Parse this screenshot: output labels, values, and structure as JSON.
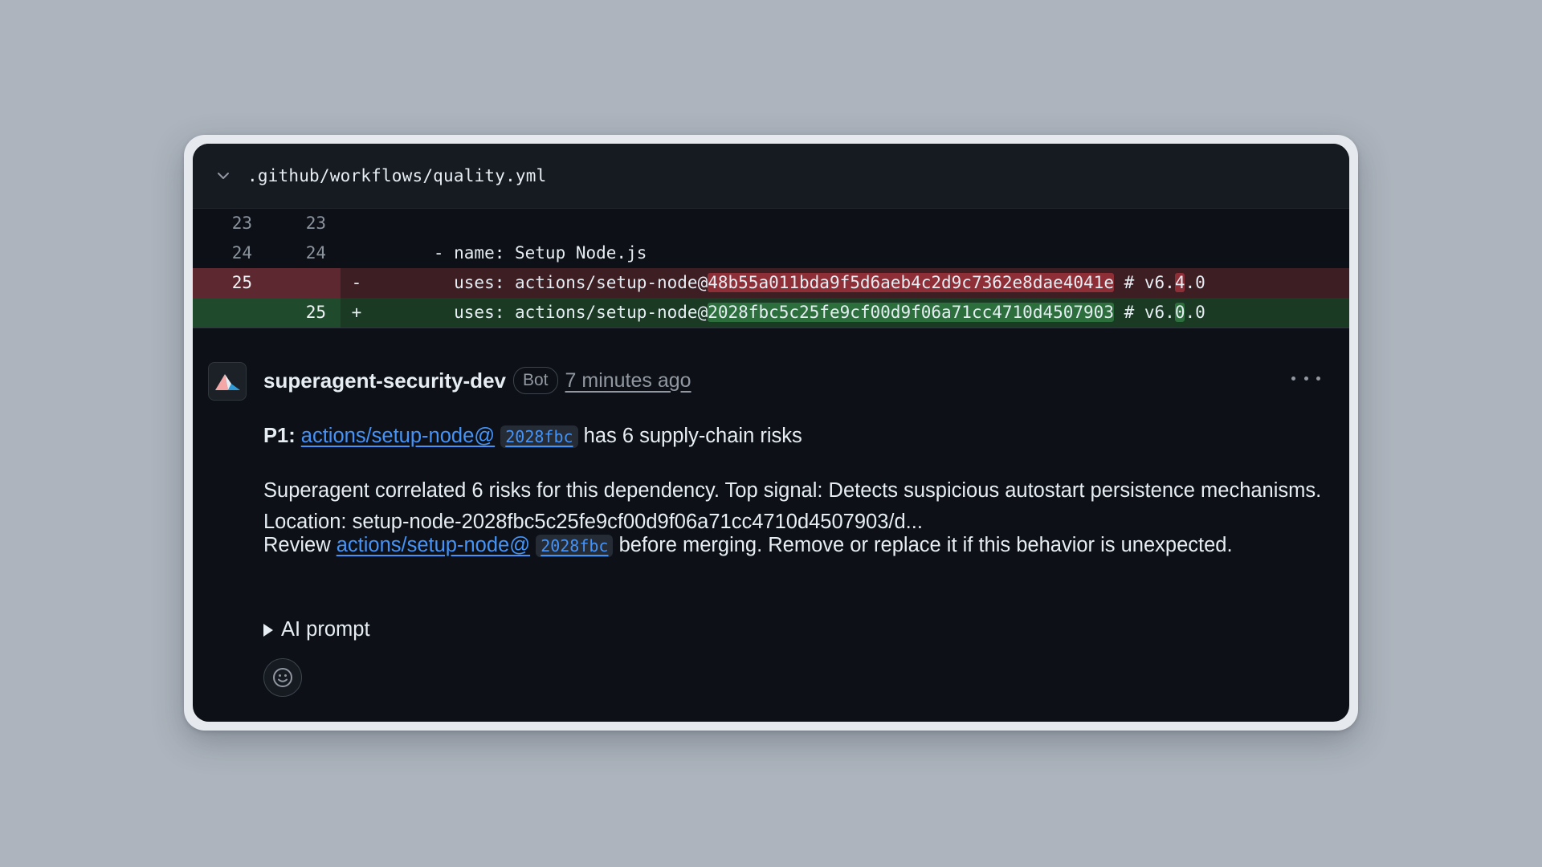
{
  "file": {
    "path": ".github/workflows/quality.yml"
  },
  "diff": {
    "rows": [
      {
        "old": "23",
        "new": "23",
        "sign": "",
        "code": ""
      },
      {
        "old": "24",
        "new": "24",
        "sign": "",
        "code": "      - name: Setup Node.js"
      },
      {
        "old": "25",
        "new": "",
        "sign": "-",
        "code_prefix": "        uses: actions/setup-node@",
        "code_hash": "48b55a011bda9f5d6aeb4c2d9c7362e8dae4041e",
        "code_mid": " # v6.",
        "code_ver": "4",
        "code_suffix": ".0"
      },
      {
        "old": "",
        "new": "25",
        "sign": "+",
        "code_prefix": "        uses: actions/setup-node@",
        "code_hash": "2028fbc5c25fe9cf00d9f06a71cc4710d4507903",
        "code_mid": " # v6.",
        "code_ver": "0",
        "code_suffix": ".0"
      }
    ]
  },
  "comment": {
    "author": "superagent-security-dev",
    "badge": "Bot",
    "time": "7 minutes ago",
    "title_prefix": "P1:",
    "title_link": "actions/setup-node@",
    "title_sha": "2028fbc",
    "title_suffix": "has 6 supply-chain risks",
    "description": "Superagent correlated 6 risks for this dependency. Top signal: Detects suspicious autostart persistence mechanisms. Location: setup-node-2028fbc5c25fe9cf00d9f06a71cc4710d4507903/d...",
    "review_prefix": "Review",
    "review_link": "actions/setup-node@",
    "review_sha": "2028fbc",
    "review_suffix": "before merging. Remove or replace it if this behavior is unexpected.",
    "details_label": "AI prompt"
  },
  "icons": {
    "chevron": "chevron-down-icon",
    "avatar": "superagent-logo",
    "kebab": "kebab-horizontal-icon",
    "reaction": "smiley-icon"
  },
  "colors": {
    "background": "#adb4bd",
    "card": "#0d1117",
    "link": "#4493f8",
    "deleted_row": "#3c1e23",
    "added_row": "#1a3a24"
  }
}
